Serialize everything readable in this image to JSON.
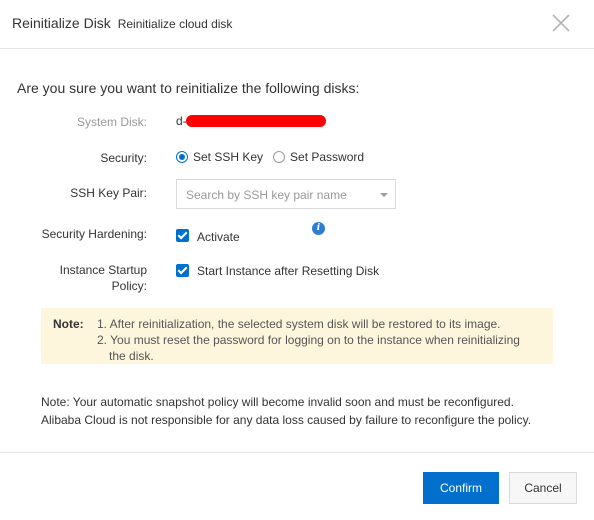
{
  "header": {
    "title": "Reinitialize Disk",
    "subtitle": "Reinitialize cloud disk",
    "close_icon": "close-icon"
  },
  "question": "Are you sure you want to reinitialize the following disks:",
  "system_disk": {
    "label": "System Disk:",
    "value_prefix": "d-"
  },
  "security": {
    "label": "Security:",
    "options": [
      {
        "label": "Set SSH Key",
        "checked": true
      },
      {
        "label": "Set Password",
        "checked": false
      }
    ]
  },
  "ssh_key_pair": {
    "label": "SSH Key Pair:",
    "placeholder": "Search by SSH key pair name"
  },
  "security_hardening": {
    "label": "Security Hardening:",
    "checkbox_label": "Activate",
    "checked": true,
    "info_icon": "info-icon"
  },
  "startup_policy": {
    "label_line1": "Instance Startup",
    "label_line2": "Policy:",
    "checkbox_label": "Start Instance after Resetting Disk",
    "checked": true
  },
  "note": {
    "title": "Note:",
    "line1": "1. After reinitialization, the selected system disk will be restored to its image.",
    "line2a": "2. You must reset the password for logging on to the instance when reinitializing",
    "line2b": "the disk."
  },
  "footer_note": {
    "line1": "Note: Your automatic snapshot policy will become invalid soon and must be reconfigured.",
    "line2": "Alibaba Cloud is not responsible for any data loss caused by failure to reconfigure the policy."
  },
  "buttons": {
    "confirm": "Confirm",
    "cancel": "Cancel"
  },
  "colors": {
    "primary": "#0070cc",
    "note_bg": "#fdf6dd",
    "redaction": "#ff0000"
  }
}
